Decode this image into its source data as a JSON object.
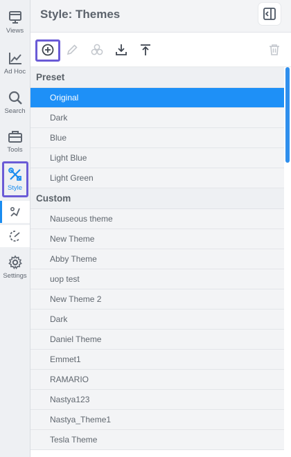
{
  "rail": {
    "views_label": "Views",
    "adhoc_label": "Ad Hoc",
    "search_label": "Search",
    "tools_label": "Tools",
    "style_label": "Style",
    "settings_label": "Settings"
  },
  "header": {
    "title": "Style: Themes"
  },
  "toolbar": {
    "add": "add-icon",
    "edit": "pencil-icon",
    "duplicate": "palette-icon",
    "import": "download-icon",
    "export": "upload-icon",
    "delete": "trash-icon"
  },
  "list": {
    "preset_label": "Preset",
    "preset": [
      "Original",
      "Dark",
      "Blue",
      "Light Blue",
      "Light Green"
    ],
    "custom_label": "Custom",
    "custom": [
      "Nauseous theme",
      "New Theme",
      "Abby Theme",
      "uop test",
      "New Theme 2",
      "Dark",
      "Daniel Theme",
      "Emmet1",
      "RAMARIO",
      "Nastya123",
      "Nastya_Theme1",
      "Tesla Theme"
    ]
  },
  "colors": {
    "accent": "#1e90f7",
    "highlight": "#6a5bd6"
  }
}
